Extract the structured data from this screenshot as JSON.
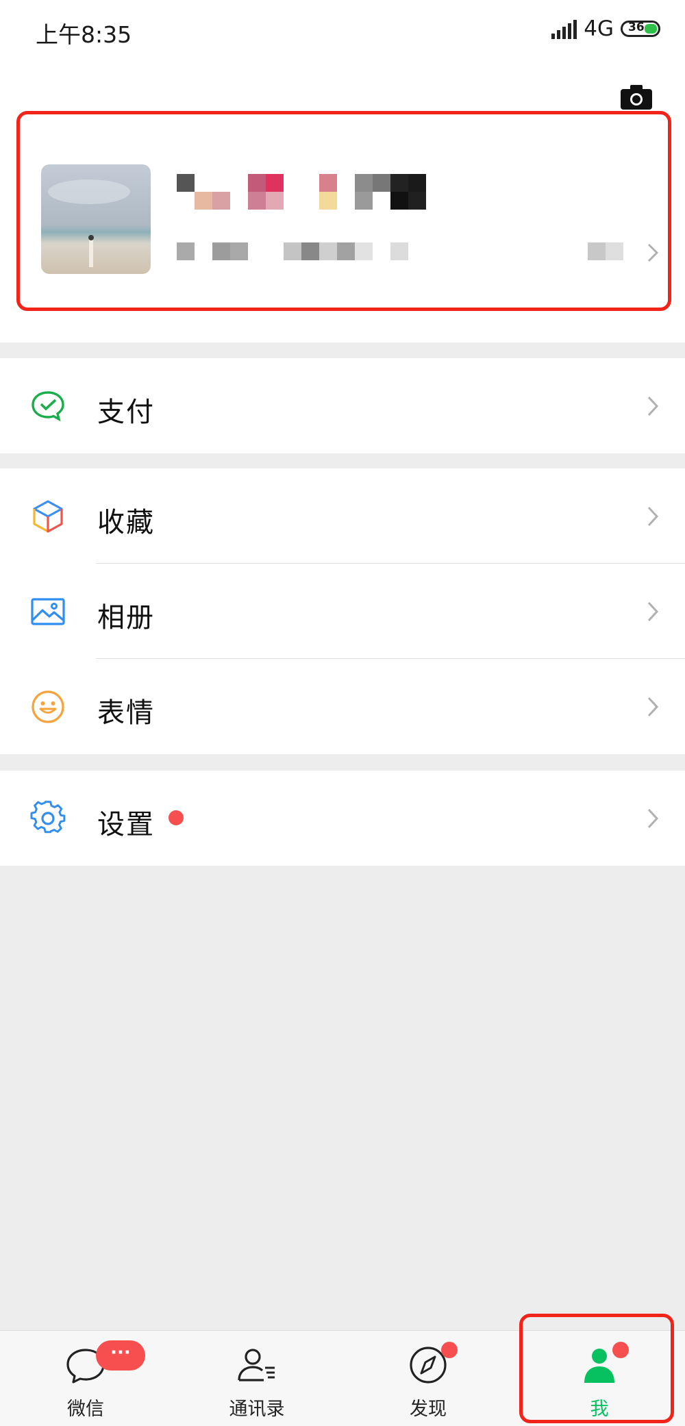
{
  "status_bar": {
    "time": "上午8:35",
    "network": "4G",
    "battery": "36"
  },
  "menu": {
    "pay": {
      "label": "支付",
      "icon": "wechat-pay-icon"
    },
    "favorites": {
      "label": "收藏",
      "icon": "favorites-cube-icon"
    },
    "album": {
      "label": "相册",
      "icon": "album-picture-icon"
    },
    "stickers": {
      "label": "表情",
      "icon": "smiley-face-icon"
    },
    "settings": {
      "label": "设置",
      "icon": "settings-gear-icon",
      "has_badge": true
    }
  },
  "tabs": [
    {
      "label": "微信",
      "icon": "chat-bubble-icon",
      "badge": "···"
    },
    {
      "label": "通讯录",
      "icon": "contacts-person-icon"
    },
    {
      "label": "发现",
      "icon": "compass-icon",
      "badge_dot": true
    },
    {
      "label": "我",
      "icon": "me-person-icon",
      "active": true,
      "badge_dot": true
    }
  ],
  "colors": {
    "accent_green": "#07c160",
    "badge_red": "#f74f4f",
    "highlight_red": "#f2241a",
    "background": "#ededed"
  }
}
